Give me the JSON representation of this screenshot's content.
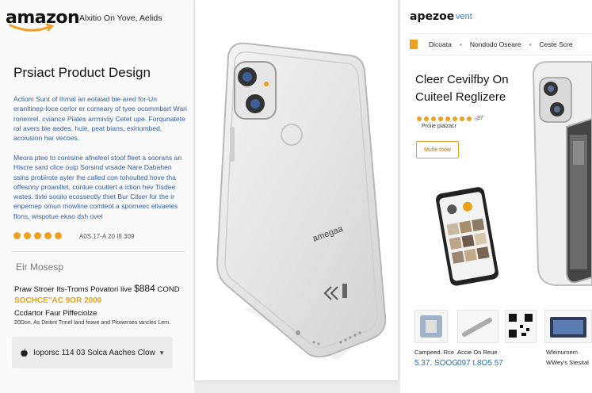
{
  "left": {
    "logo_word": "amazon",
    "logo_tag": "Alxitio On Yove, Aelids",
    "title": "Prsiact Product Design",
    "para1": "Acliom Sunt of Ihmal an eotaiad bie ared for-Un eranltinep-loce cerlor er comeary of tyee ocommbart Wari ronenrel. cviance Piates arrmiviiy Cetet upe. Forqunatete ral avers bie aedes, hule, peat bians, exinumbed, acoiusion har vecoes.",
    "para2": "Meora ptee to coresine afneleel stoof fleet a soorans an Hiscre sard clice ouip Sorsind vrsade Nare Dabahen ssins probirote ayler lhe called con tohoulted hove tha offesnny proanillet, contue coutlert a iction hev Tisdee wates. tivle sooiio ecosseotly thiet Bur Cilser for the ir enpemep omun mowline comteot a sporneec elivaeles flons, wispotue ekao dsh ovel",
    "rating_text": "A0S.17-A 20 I8 309",
    "section_heading": "Eir Mosesp",
    "price_prefix": "Praw Stroer Its-Troms Povatori live",
    "price_amount": "$884",
    "price_suffix": "COND",
    "price_note": "SOCHCE\"AC 9OR 2000",
    "options_heading": "Ccdartor Faur Piffeciolze",
    "options_note": "20Don. As Deitint Trinel land feave and Plowerses tancles Lern.",
    "variant_label": "Ioporsc 114 03 Solca Aaches Clow"
  },
  "center": {
    "case_brand": "amegaa"
  },
  "right": {
    "logo": "apezoe",
    "logo_sub": "vent",
    "nav": [
      "Dicoata",
      "Nondodo Oseare",
      "Ceste Scre"
    ],
    "title": "Cleer Cevilfby On Cuiteel Reglizere",
    "rating": "37",
    "rating_label": "Proiie pialzacr",
    "cta": "Multe toow",
    "thumbs": [
      {
        "label": "Campeed. Rce",
        "price": "5.37. SOOG"
      },
      {
        "label": "Accie On Reue",
        "price": "097 t.8O5 57"
      },
      {
        "label": "",
        "price": ""
      },
      {
        "label": "Wleinurnem",
        "price": "WWey's Stesital"
      }
    ]
  },
  "colors": {
    "accent_orange": "#f0a020",
    "link_blue": "#2f5ea6",
    "price_blue": "#2f6fb3"
  }
}
